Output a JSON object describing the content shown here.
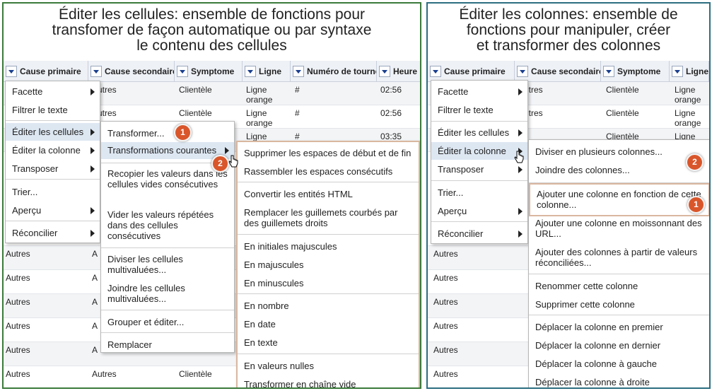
{
  "left": {
    "title": "Éditer les cellules: ensemble de fonctions pour\ntransfomer de façon automatique ou par syntaxe\nle contenu des cellules",
    "headers": [
      "Cause primaire",
      "Cause secondaire",
      "Symptome",
      "Ligne",
      "Numéro de tournée",
      "Heure"
    ],
    "top_rows": [
      {
        "c1": "Autres",
        "c2": "Clientèle",
        "c3": "Ligne orange",
        "c4": "#",
        "c5": "02:56"
      },
      {
        "c1": "Autres",
        "c2": "Clientèle",
        "c3": "Ligne orange",
        "c4": "#",
        "c5": "02:56"
      },
      {
        "c1": "",
        "c2": "",
        "c3": "Ligne",
        "c4": "#",
        "c5": "03:35"
      }
    ],
    "bottom_rows": [
      {
        "c0": "Autres",
        "c1": "A",
        "c2": ""
      },
      {
        "c0": "Autres",
        "c1": "A",
        "c2": ""
      },
      {
        "c0": "Autres",
        "c1": "A",
        "c2": ""
      },
      {
        "c0": "Autres",
        "c1": "A",
        "c2": ""
      },
      {
        "c0": "Autres",
        "c1": "A",
        "c2": ""
      },
      {
        "c0": "Autres",
        "c1": "Autres",
        "c2": "Clientèle"
      }
    ],
    "menu": [
      "Facette",
      "Filtrer le texte",
      "Éditer les cellules",
      "Éditer la colonne",
      "Transposer",
      "Trier...",
      "Aperçu",
      "Réconcilier"
    ],
    "submenu": [
      "Transformer...",
      "Transformations courantes",
      "Recopier les valeurs dans les cellules vides consécutives",
      "Vider les valeurs répétées dans des cellules consécutives",
      "Diviser les cellules multivaluées...",
      "Joindre les cellules multivaluées...",
      "Grouper et éditer...",
      "Remplacer"
    ],
    "submenu2": [
      "Supprimer les espaces de début et de fin",
      "Rassembler les espaces consécutifs",
      "Convertir les entités HTML",
      "Remplacer les guillemets courbés par des guillemets droits",
      "En initiales majuscules",
      "En majuscules",
      "En minuscules",
      "En nombre",
      "En date",
      "En texte",
      "En valeurs nulles",
      "Transformer en chaîne vide"
    ],
    "badges": [
      "1",
      "2"
    ]
  },
  "right": {
    "title": "Éditer les colonnes: ensemble de\nfonctions pour manipuler, créer\net transformer des colonnes",
    "headers": [
      "Cause primaire",
      "Cause secondaire",
      "Symptome",
      "Ligne"
    ],
    "top_rows": [
      {
        "c1": "Autres",
        "c2": "Clientèle",
        "c3": "Ligne orange"
      },
      {
        "c1": "Autres",
        "c2": "Clientèle",
        "c3": "Ligne orange"
      },
      {
        "c1": "",
        "c2": "Clientèle",
        "c3": "Ligne"
      }
    ],
    "bottom_rows": [
      "Autres",
      "Autres",
      "Autres",
      "Autres",
      "Autres",
      "Autres"
    ],
    "menu": [
      "Facette",
      "Filtrer le texte",
      "Éditer les cellules",
      "Éditer la colonne",
      "Transposer",
      "Trier...",
      "Aperçu",
      "Réconcilier"
    ],
    "submenu": [
      "Diviser en plusieurs colonnes...",
      "Joindre des colonnes...",
      "Ajouter une colonne en fonction de cette colonne...",
      "Ajouter une colonne en moissonnant des URL...",
      "Ajouter des colonnes à partir de valeurs réconciliées...",
      "Renommer cette colonne",
      "Supprimer cette colonne",
      "Déplacer la colonne en premier",
      "Déplacer la colonne en dernier",
      "Déplacer la colonne à gauche",
      "Déplacer la colonne à droite"
    ],
    "badges": [
      "2",
      "1"
    ]
  },
  "colors": {
    "left_border": "#3b7a3b",
    "right_border": "#2c6e80",
    "badge": "#d9562b",
    "submenu_highlight_border": "#d9b7a0"
  }
}
